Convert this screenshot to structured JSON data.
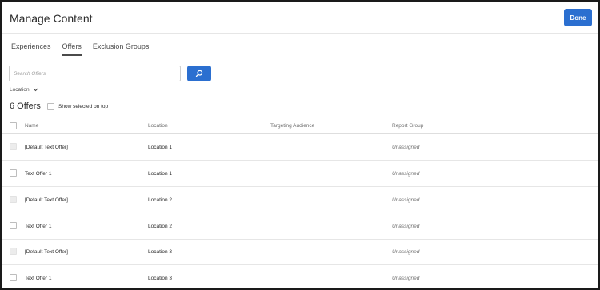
{
  "header": {
    "title": "Manage Content",
    "done_label": "Done"
  },
  "tabs": [
    {
      "label": "Experiences",
      "active": false
    },
    {
      "label": "Offers",
      "active": true
    },
    {
      "label": "Exclusion Groups",
      "active": false
    }
  ],
  "search": {
    "placeholder": "Search Offers"
  },
  "filter": {
    "location_label": "Location"
  },
  "offers": {
    "count_label": "6 Offers",
    "show_selected_label": "Show selected on top"
  },
  "table": {
    "columns": [
      "Name",
      "Location",
      "Targeting Audience",
      "Report Group"
    ],
    "rows": [
      {
        "name": "[Default Text Offer]",
        "location": "Location 1",
        "audience": "",
        "report_group": "Unassigned",
        "checkbox_disabled": true
      },
      {
        "name": "Text Offer 1",
        "location": "Location 1",
        "audience": "",
        "report_group": "Unassigned",
        "checkbox_disabled": false
      },
      {
        "name": "[Default Text Offer]",
        "location": "Location 2",
        "audience": "",
        "report_group": "Unassigned",
        "checkbox_disabled": true
      },
      {
        "name": "Text Offer 1",
        "location": "Location 2",
        "audience": "",
        "report_group": "Unassigned",
        "checkbox_disabled": false
      },
      {
        "name": "[Default Text Offer]",
        "location": "Location 3",
        "audience": "",
        "report_group": "Unassigned",
        "checkbox_disabled": true
      },
      {
        "name": "Text Offer 1",
        "location": "Location 3",
        "audience": "",
        "report_group": "Unassigned",
        "checkbox_disabled": false
      }
    ]
  },
  "colors": {
    "accent": "#2b6fd0"
  },
  "icons": {
    "search": "search-icon",
    "dropdown": "chevron-down-icon"
  }
}
